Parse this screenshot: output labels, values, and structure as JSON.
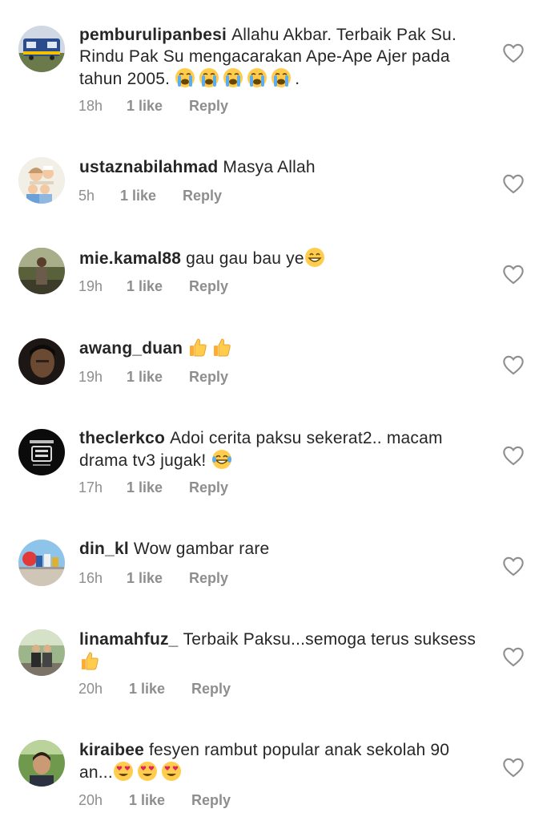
{
  "comments": [
    {
      "username": "pemburulipanbesi",
      "text": "Allahu Akbar. Terbaik Pak Su. Rindu Pak Su mengacarakan Ape-Ape Ajer pada tahun 2005.",
      "emoji": [
        "loudly-crying-face",
        "loudly-crying-face",
        "loudly-crying-face",
        "loudly-crying-face",
        "loudly-crying-face"
      ],
      "suffix": ".",
      "time": "18h",
      "likes": "1 like",
      "reply": "Reply",
      "avatar_icon": "train-avatar"
    },
    {
      "username": "ustaznabilahmad",
      "text": "Masya Allah",
      "emoji": [],
      "suffix": "",
      "time": "5h",
      "likes": "1 like",
      "reply": "Reply",
      "avatar_icon": "family-cartoon-avatar"
    },
    {
      "username": "mie.kamal88",
      "text": "gau gau bau ye",
      "emoji": [
        "grinning-face"
      ],
      "suffix": "",
      "time": "19h",
      "likes": "1 like",
      "reply": "Reply",
      "avatar_icon": "person-outdoor-avatar"
    },
    {
      "username": "awang_duan",
      "text": "",
      "emoji": [
        "thumbs-up",
        "thumbs-up"
      ],
      "suffix": "",
      "time": "19h",
      "likes": "1 like",
      "reply": "Reply",
      "avatar_icon": "person-portrait-avatar"
    },
    {
      "username": "theclerkco",
      "text": "Adoi cerita paksu sekerat2.. macam drama tv3 jugak!",
      "emoji": [
        "tears-of-joy-face"
      ],
      "suffix": "",
      "time": "17h",
      "likes": "1 like",
      "reply": "Reply",
      "avatar_icon": "logo-avatar"
    },
    {
      "username": "din_kl",
      "text": "Wow gambar rare",
      "emoji": [],
      "suffix": "",
      "time": "16h",
      "likes": "1 like",
      "reply": "Reply",
      "avatar_icon": "landmark-avatar"
    },
    {
      "username": "linamahfuz_",
      "text": "Terbaik Paksu...semoga terus suksess",
      "emoji": [
        "thumbs-up"
      ],
      "suffix": "",
      "time": "20h",
      "likes": "1 like",
      "reply": "Reply",
      "avatar_icon": "couple-avatar"
    },
    {
      "username": "kiraibee",
      "text": "fesyen rambut popular anak sekolah 90 an...",
      "emoji": [
        "heart-eyes-face",
        "heart-eyes-face",
        "heart-eyes-face"
      ],
      "suffix": "",
      "time": "20h",
      "likes": "1 like",
      "reply": "Reply",
      "avatar_icon": "person-greenery-avatar"
    }
  ],
  "colors": {
    "text": "#262626",
    "meta": "#8e8e8e",
    "heart_outline": "#8e8e8e"
  }
}
